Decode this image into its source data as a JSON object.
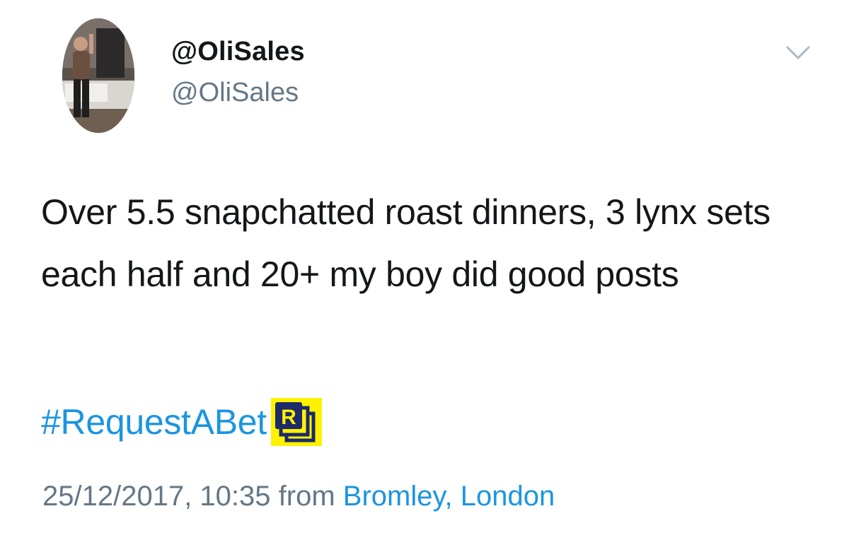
{
  "tweet": {
    "display_name": "@OliSales",
    "handle": "@OliSales",
    "avatar_icon": "profile-photo",
    "menu_icon": "chevron-down-icon",
    "text": "Over 5.5 snapchatted roast dinners, 3 lynx sets each half and 20+ my boy did good posts",
    "hashtag": "#RequestABet",
    "hashflag_icon": "requestabet-hashflag",
    "hashflag_letter": "R",
    "timestamp": "25/12/2017, 10:35",
    "from_label": "from",
    "location": "Bromley, London"
  },
  "colors": {
    "link": "#1b95e0",
    "secondary_text": "#657786",
    "primary_text": "#14171a",
    "hashflag_yellow": "#fff200",
    "hashflag_navy": "#1d2a6b"
  }
}
